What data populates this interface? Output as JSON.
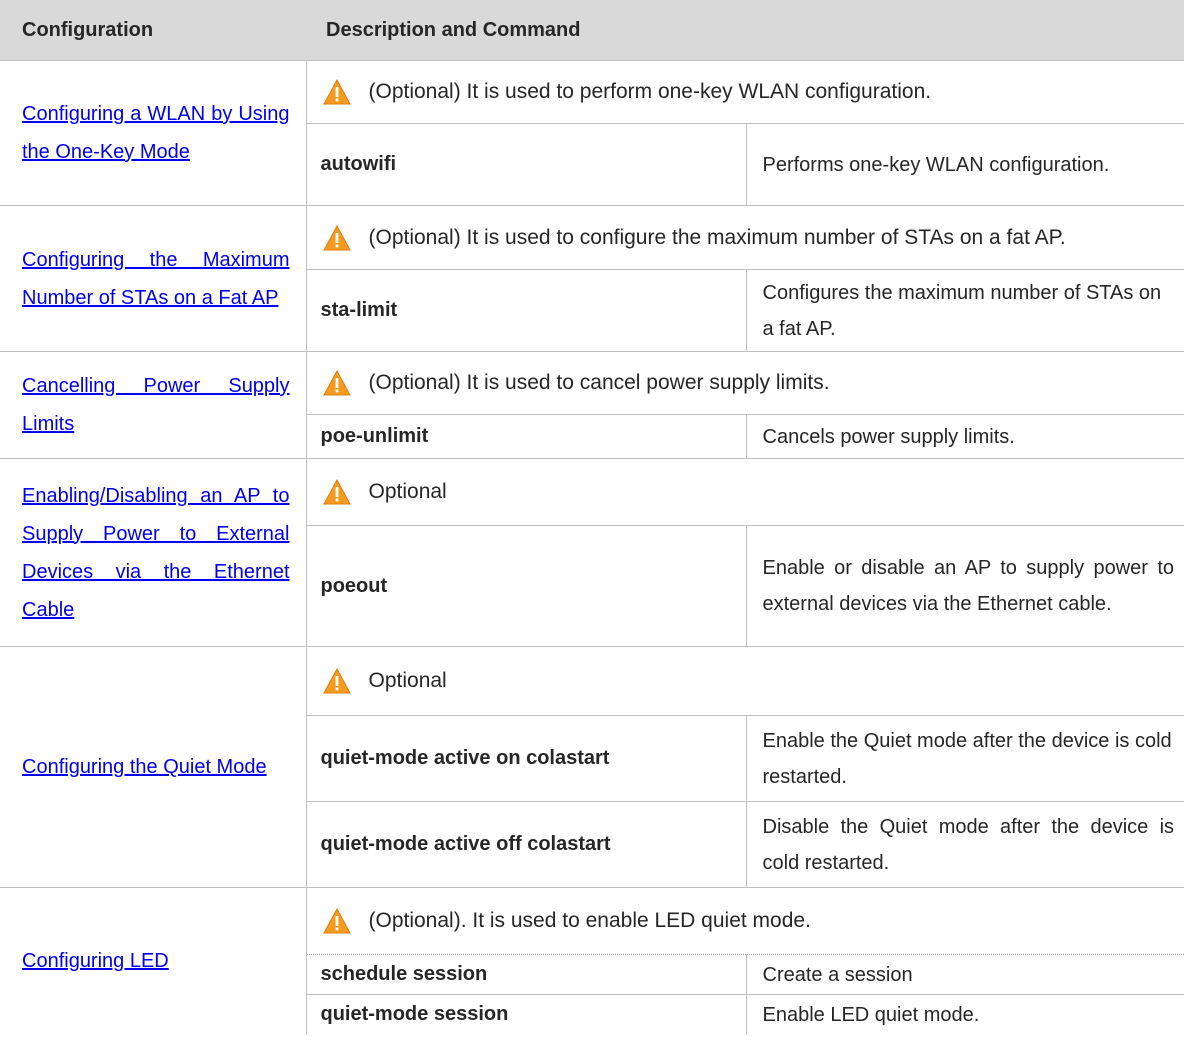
{
  "header": {
    "col1": "Configuration",
    "col2": "Description and Command"
  },
  "rows": [
    {
      "config": "Configuring a WLAN by Using the One-Key Mode",
      "note": "(Optional) It is used to perform one-key WLAN configuration.",
      "commands": [
        {
          "cmd": "autowifi",
          "desc": "Performs one-key WLAN configuration."
        }
      ]
    },
    {
      "config": "Configuring the Maximum Number of STAs on a Fat AP",
      "note": "(Optional) It is used to configure the maximum number of STAs on a fat AP.",
      "commands": [
        {
          "cmd": "sta-limit",
          "desc": "Configures the maximum number of STAs on a fat AP."
        }
      ]
    },
    {
      "config": "Cancelling Power Supply Limits",
      "note": "(Optional) It is used to cancel power supply limits.",
      "commands": [
        {
          "cmd": "poe-unlimit",
          "desc": "Cancels power supply limits."
        }
      ]
    },
    {
      "config": "Enabling/Disabling an AP to Supply Power to External Devices via the Ethernet Cable",
      "note": "Optional",
      "commands": [
        {
          "cmd": "poeout",
          "desc": "Enable or disable an AP to supply power to external devices via the Ethernet cable."
        }
      ]
    },
    {
      "config": "Configuring the Quiet Mode",
      "note": "Optional",
      "commands": [
        {
          "cmd": "quiet-mode active on colastart",
          "desc": "Enable the Quiet mode after the device is cold restarted."
        },
        {
          "cmd": "quiet-mode active off colastart",
          "desc": "Disable the Quiet mode after the device is cold restarted."
        }
      ]
    },
    {
      "config": "Configuring LED",
      "note": "(Optional). It is used to enable LED quiet mode.",
      "commands": [
        {
          "cmd": "schedule session",
          "desc": "Create a session"
        },
        {
          "cmd": "quiet-mode session",
          "desc": "Enable LED quiet mode."
        }
      ]
    }
  ],
  "icons": {
    "note": "warning-triangle-icon"
  },
  "colors": {
    "header_bg": "#d9d9d9",
    "link": "#0000ee",
    "warning_fill": "#f39a1f",
    "warning_mark": "#ffffff"
  }
}
